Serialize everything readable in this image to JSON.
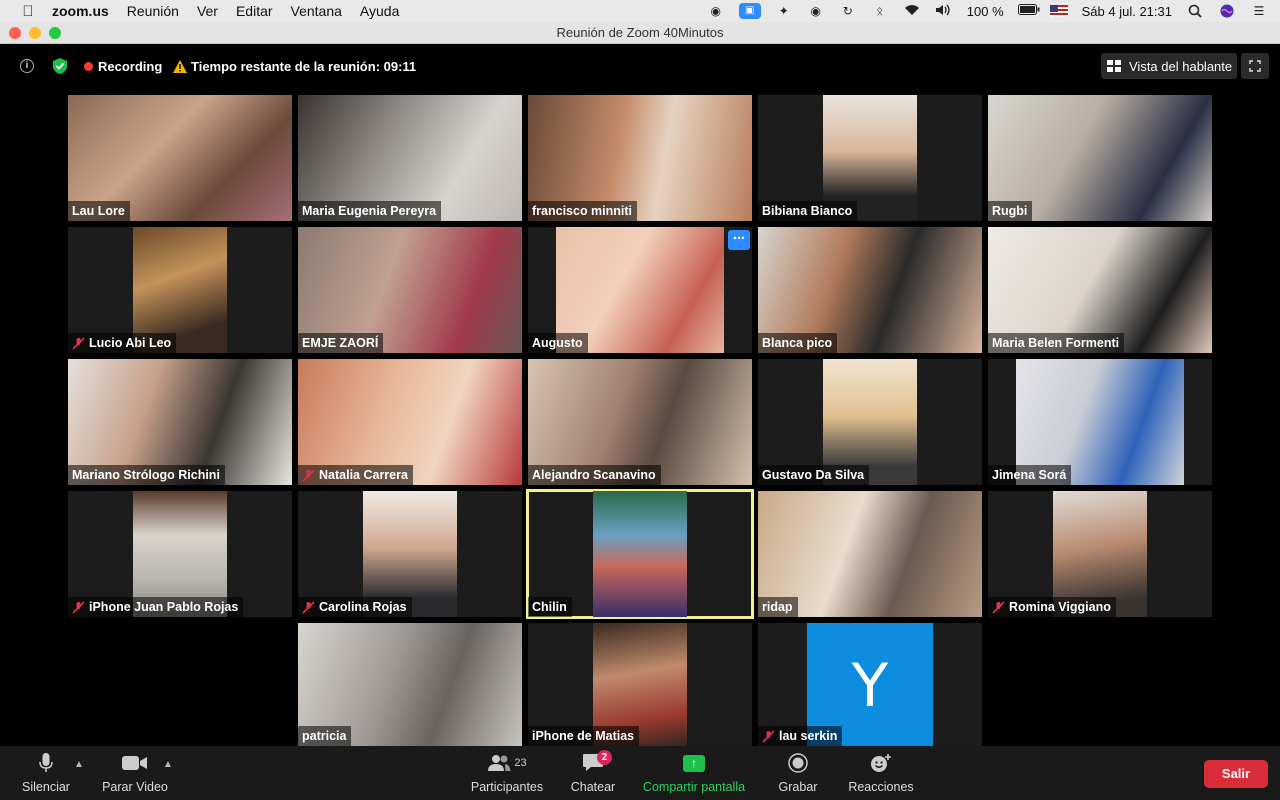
{
  "menubar": {
    "app_name": "zoom.us",
    "menus": [
      "Reunión",
      "Ver",
      "Editar",
      "Ventana",
      "Ayuda"
    ],
    "battery": "100 %",
    "clock": "Sáb 4 jul.  21:31"
  },
  "window": {
    "title": "Reunión de Zoom   40Minutos"
  },
  "infobar": {
    "info_glyph": "i",
    "recording_label": "Recording",
    "time_remaining": "Tiempo restante de la reunión: 09:11",
    "speaker_view_label": "Vista del hablante"
  },
  "participants": [
    {
      "name": "Lau Lore",
      "muted": false
    },
    {
      "name": "Maria Eugenia Pereyra",
      "muted": false
    },
    {
      "name": "francisco minniti",
      "muted": false
    },
    {
      "name": "Bibiana Bianco",
      "muted": false
    },
    {
      "name": "Rugbi",
      "muted": false
    },
    {
      "name": "Lucio Abi Leo",
      "muted": true
    },
    {
      "name": "EMJE ZAORÍ",
      "muted": false
    },
    {
      "name": "Augusto",
      "muted": false
    },
    {
      "name": "Blanca pico",
      "muted": false
    },
    {
      "name": "Maria Belen Formenti",
      "muted": false
    },
    {
      "name": "Mariano Strólogo Richini",
      "muted": false
    },
    {
      "name": "Natalia Carrera",
      "muted": true
    },
    {
      "name": "Alejandro Scanavino",
      "muted": false
    },
    {
      "name": "Gustavo Da Silva",
      "muted": false
    },
    {
      "name": "Jimena Sorá",
      "muted": false
    },
    {
      "name": "iPhone Juan Pablo Rojas",
      "muted": true
    },
    {
      "name": "Carolina Rojas",
      "muted": true
    },
    {
      "name": "Chilin",
      "muted": false,
      "active_speaker": true
    },
    {
      "name": "ridap",
      "muted": false
    },
    {
      "name": "Romina Viggiano",
      "muted": true
    },
    {
      "name": "patricia",
      "muted": false
    },
    {
      "name": "iPhone de Matias",
      "muted": false
    },
    {
      "name": "lau serkin",
      "muted": true,
      "avatar_letter": "Y"
    }
  ],
  "toolbar": {
    "mute_label": "Silenciar",
    "video_label": "Parar Video",
    "participants_label": "Participantes",
    "participants_count": "23",
    "chat_label": "Chatear",
    "chat_badge": "2",
    "share_label": "Compartir pantalla",
    "record_label": "Grabar",
    "reactions_label": "Reacciones",
    "leave_label": "Salir"
  },
  "colors": {
    "accent_blue": "#2d8cff",
    "share_green": "#2fd25a",
    "leave_red": "#d92d39",
    "active_speaker_border": "#f2f28c",
    "recording_red": "#ff3b30"
  }
}
